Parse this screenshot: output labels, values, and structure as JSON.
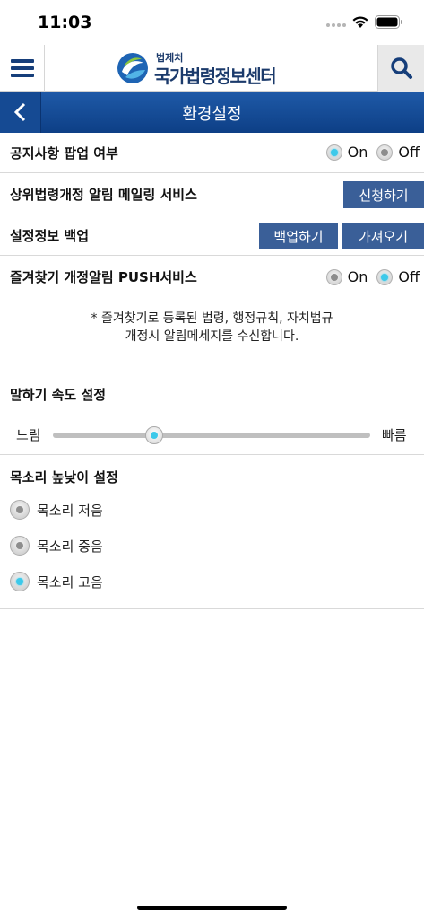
{
  "status_bar": {
    "time": "11:03"
  },
  "header": {
    "logo_sub": "법제처",
    "logo_main": "국가법령정보센터"
  },
  "title_bar": {
    "title": "환경설정"
  },
  "settings": {
    "notice_popup": {
      "label": "공지사항 팝업 여부",
      "on_label": "On",
      "off_label": "Off",
      "selected": "On"
    },
    "mailing_service": {
      "label": "상위법령개정 알림 메일링 서비스",
      "button": "신청하기"
    },
    "backup": {
      "label": "설정정보 백업",
      "backup_button": "백업하기",
      "import_button": "가져오기"
    },
    "push_service": {
      "label": "즐겨찾기 개정알림 PUSH서비스",
      "on_label": "On",
      "off_label": "Off",
      "selected": "Off",
      "note_line1": "* 즐겨찾기로 등록된 법령, 행정규칙, 자치법규",
      "note_line2": "개정시 알림메세지를 수신합니다."
    },
    "speech_speed": {
      "label": "말하기 속도 설정",
      "min_label": "느림",
      "max_label": "빠름",
      "value_fraction": 0.32
    },
    "voice_pitch": {
      "label": "목소리 높낮이 설정",
      "options": [
        "목소리 저음",
        "목소리 중음",
        "목소리 고음"
      ],
      "selected": "목소리 고음"
    }
  },
  "colors": {
    "brand_navy": "#1b3a6b",
    "title_bar_blue": "#0d3f86",
    "button_blue": "#3a5f98",
    "radio_active": "#3cc9ea"
  }
}
